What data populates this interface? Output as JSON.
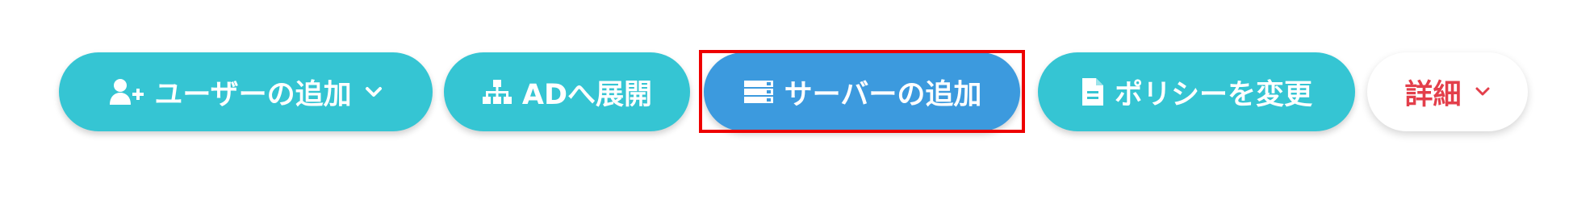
{
  "toolbar": {
    "add_user": {
      "label": "ユーザーの追加",
      "icon": "user-plus-icon",
      "has_dropdown": true
    },
    "deploy_ad": {
      "label": "ADへ展開",
      "icon": "sitemap-icon"
    },
    "add_server": {
      "label": "サーバーの追加",
      "icon": "server-icon",
      "highlighted": true
    },
    "change_policy": {
      "label": "ポリシーを変更",
      "icon": "file-icon"
    },
    "details": {
      "label": "詳細",
      "icon": "chevron-down-icon",
      "has_dropdown": true
    }
  },
  "colors": {
    "teal": "#35c5d3",
    "blue": "#3c9ade",
    "details_text": "#e33f4b",
    "highlight_border": "#ee0000"
  }
}
